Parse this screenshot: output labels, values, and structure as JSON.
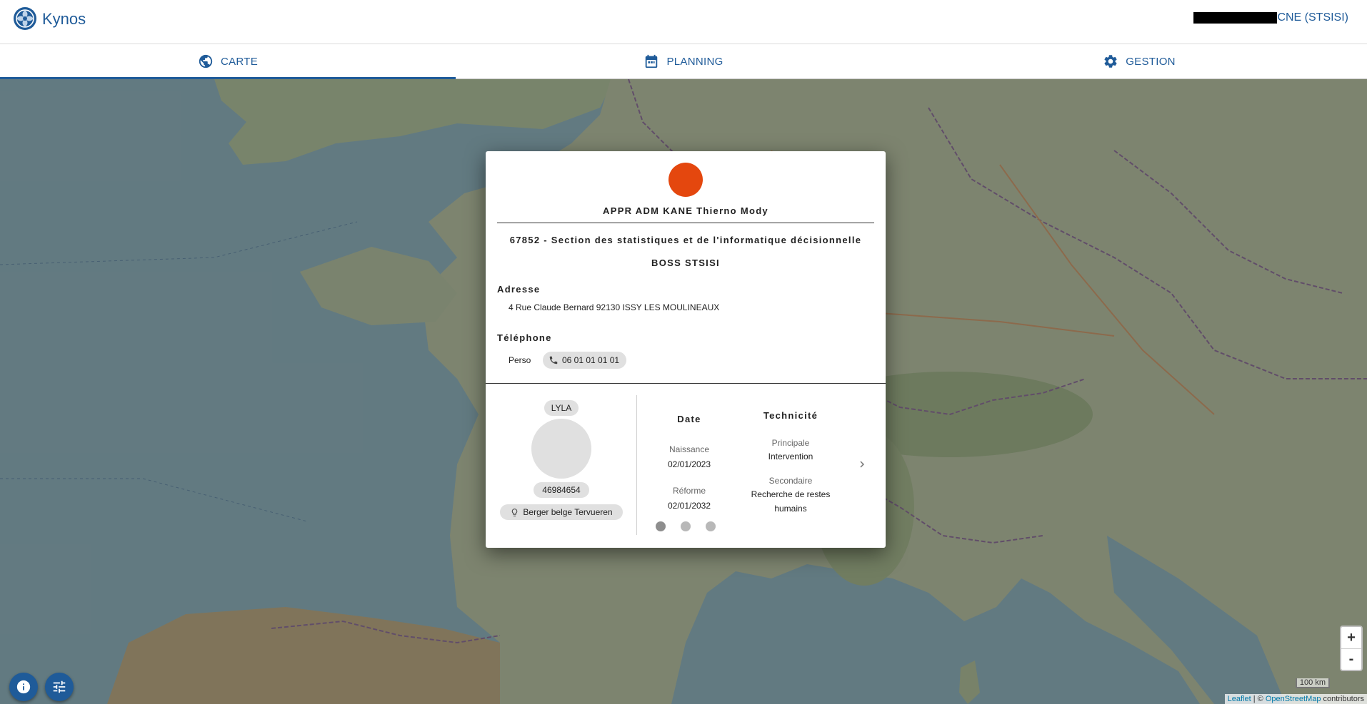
{
  "app": {
    "title": "Kynos"
  },
  "user": {
    "name": "CNE (STSISI)"
  },
  "tabs": [
    {
      "label": "CARTE",
      "icon": "globe-icon",
      "active": true
    },
    {
      "label": "PLANNING",
      "icon": "calendar-icon",
      "active": false
    },
    {
      "label": "GESTION",
      "icon": "gear-icon",
      "active": false
    }
  ],
  "map": {
    "zoom_in": "+",
    "zoom_out": "-",
    "scale": "100 km",
    "attribution": {
      "leaflet": "Leaflet",
      "sep": " | © ",
      "osm": "OpenStreetMap",
      "suffix": " contributors"
    }
  },
  "dialog": {
    "status_color": "#e4470e",
    "name": "APPR ADM KANE Thierno Mody",
    "unit": "67852 - Section des statistiques et de l'informatique décisionnelle",
    "role": "BOSS STSISI",
    "address_label": "Adresse",
    "address": "4 Rue Claude Bernard 92130 ISSY LES MOULINEAUX",
    "phone_label": "Téléphone",
    "phone_type": "Perso",
    "phone_number": "06 01 01 01 01",
    "dog": {
      "name": "LYLA",
      "id": "46984654",
      "breed": "Berger belge Tervueren"
    },
    "dates": {
      "title": "Date",
      "birth_label": "Naissance",
      "birth_value": "02/01/2023",
      "reform_label": "Réforme",
      "reform_value": "02/01/2032"
    },
    "tech": {
      "title": "Technicité",
      "primary_label": "Principale",
      "primary_value": "Intervention",
      "secondary_label": "Secondaire",
      "secondary_value": "Recherche de restes humains"
    },
    "carousel": {
      "count": 3,
      "active": 0
    }
  }
}
